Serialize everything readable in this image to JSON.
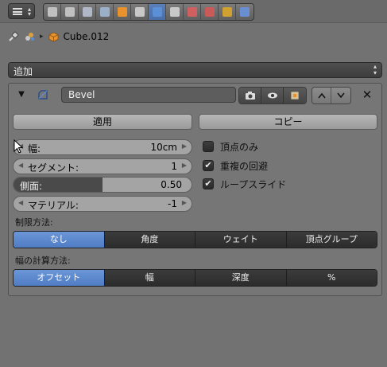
{
  "header": {
    "editor_type_icon": "properties-editor-icon",
    "tabs": [
      {
        "icon": "render-icon",
        "color": "#c0c0c0",
        "active": false
      },
      {
        "icon": "render-layers-icon",
        "color": "#c0c0c0",
        "active": false
      },
      {
        "icon": "scene-icon",
        "color": "#b0b8c8",
        "active": false
      },
      {
        "icon": "world-icon",
        "color": "#9ab0c8",
        "active": false
      },
      {
        "icon": "object-icon",
        "color": "#e8922e",
        "active": false
      },
      {
        "icon": "constraints-icon",
        "color": "#c8c8c8",
        "active": false
      },
      {
        "icon": "modifiers-wrench-icon",
        "color": "#5b8fd6",
        "active": true
      },
      {
        "icon": "data-mesh-icon",
        "color": "#c8c8c8",
        "active": false
      },
      {
        "icon": "material-icon",
        "color": "#d06060",
        "active": false
      },
      {
        "icon": "texture-icon",
        "color": "#c85a5a",
        "active": false
      },
      {
        "icon": "particles-icon",
        "color": "#d0a030",
        "active": false
      },
      {
        "icon": "physics-icon",
        "color": "#6a8fd0",
        "active": false
      }
    ]
  },
  "breadcrumb": {
    "object_name": "Cube.012"
  },
  "add_modifier": {
    "label": "追加"
  },
  "modifier": {
    "name": "Bevel",
    "apply_label": "適用",
    "copy_label": "コピー",
    "fields": {
      "width": {
        "label": "幅:",
        "value": "10cm"
      },
      "segments": {
        "label": "セグメント:",
        "value": "1"
      },
      "profile": {
        "label": "側面:",
        "value": "0.50",
        "fill_fraction": 0.5
      },
      "material": {
        "label": "マテリアル:",
        "value": "-1"
      }
    },
    "checkboxes": [
      {
        "label": "頂点のみ",
        "checked": false
      },
      {
        "label": "重複の回避",
        "checked": true
      },
      {
        "label": "ループスライド",
        "checked": true
      }
    ],
    "limit_method": {
      "label": "制限方法:",
      "options": [
        "なし",
        "角度",
        "ウェイト",
        "頂点グループ"
      ],
      "selected": 0
    },
    "width_method": {
      "label": "幅の計算方法:",
      "options": [
        "オフセット",
        "幅",
        "深度",
        "%"
      ],
      "selected": 0
    }
  },
  "colors": {
    "accent": "#5b8fd6",
    "panel_bg": "#767676"
  }
}
